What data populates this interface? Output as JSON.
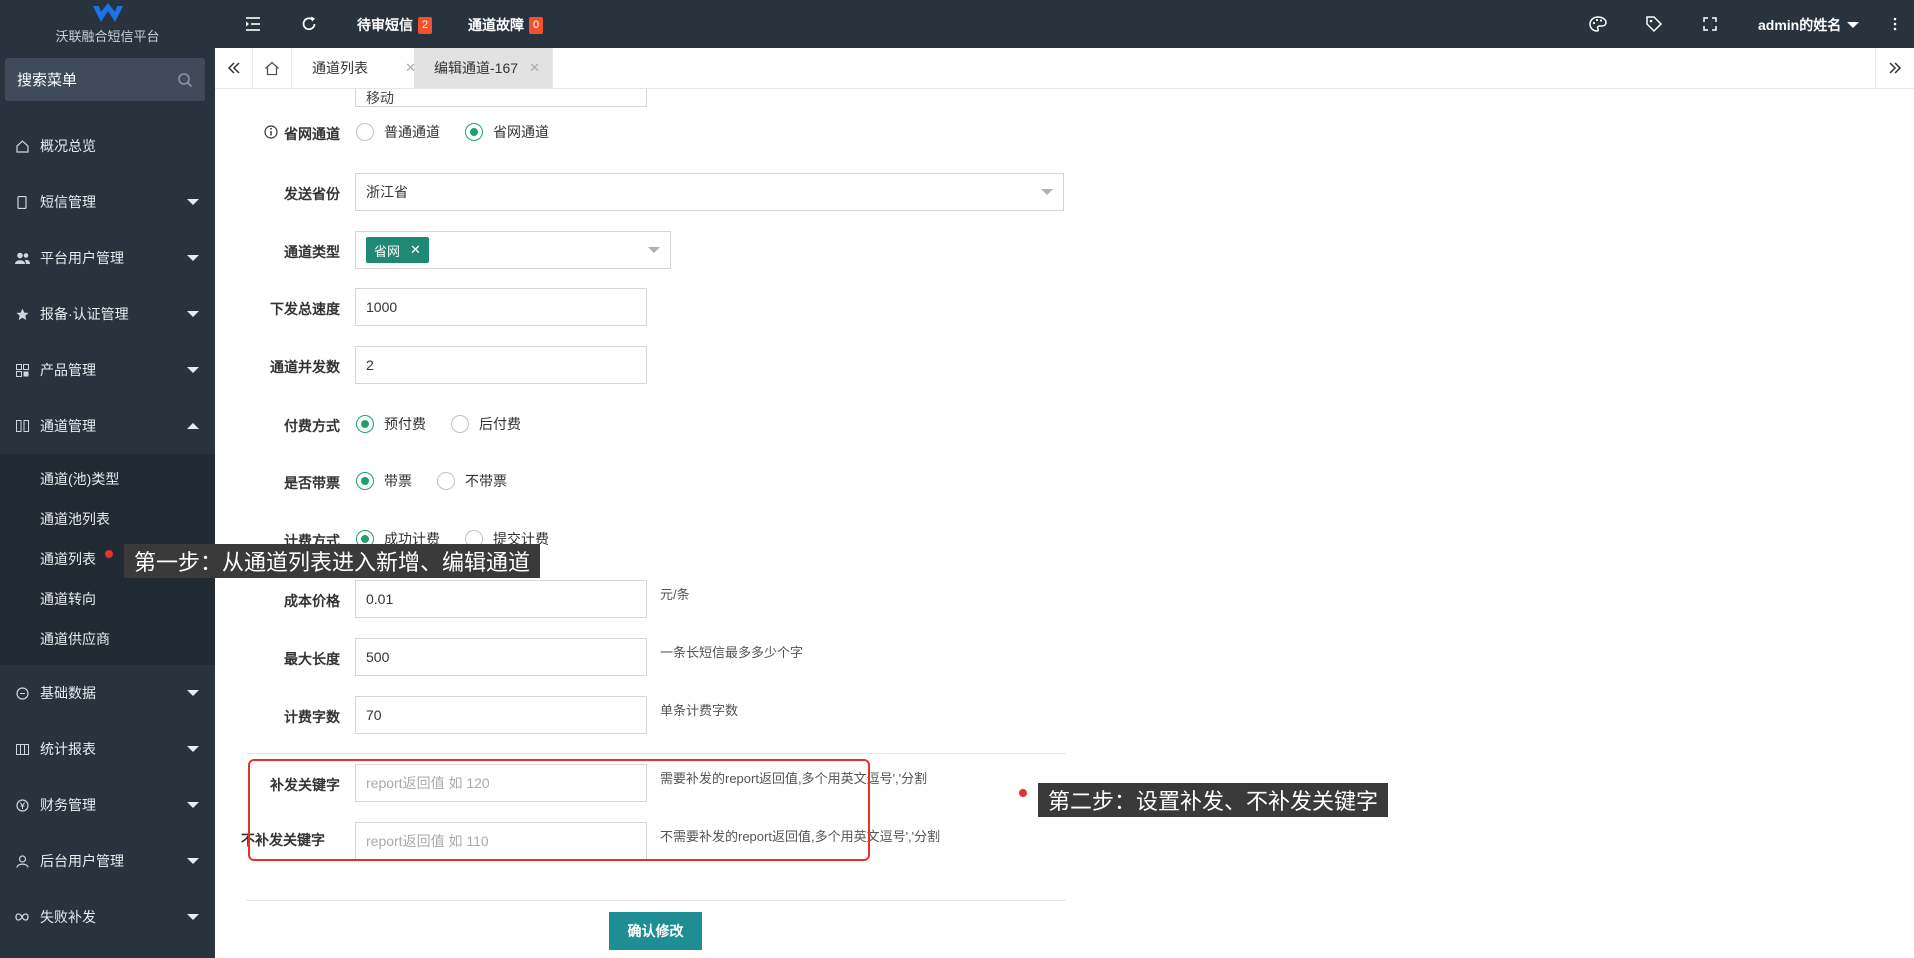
{
  "app": {
    "name": "沃联融合短信平台",
    "accent": "#1e8e94",
    "sidebar_bg": "#28333e",
    "highlight": "#e8312b"
  },
  "sidebar": {
    "search_placeholder": "搜索菜单",
    "items": [
      {
        "label": "概况总览",
        "icon": "home-icon"
      },
      {
        "label": "短信管理",
        "icon": "phone-icon"
      },
      {
        "label": "平台用户管理",
        "icon": "users-icon"
      },
      {
        "label": "报备·认证管理",
        "icon": "star-icon"
      },
      {
        "label": "产品管理",
        "icon": "product-icon"
      },
      {
        "label": "通道管理",
        "icon": "channel-icon",
        "expanded": true
      },
      {
        "label": "基础数据",
        "icon": "data-icon"
      },
      {
        "label": "统计报表",
        "icon": "report-icon"
      },
      {
        "label": "财务管理",
        "icon": "yen-icon"
      },
      {
        "label": "后台用户管理",
        "icon": "user-icon"
      },
      {
        "label": "失败补发",
        "icon": "infinity-icon"
      }
    ],
    "subitems": [
      "通道(池)类型",
      "通道池列表",
      "通道列表",
      "通道转向",
      "通道供应商"
    ]
  },
  "topbar": {
    "pending_sms": "待审短信",
    "pending_sms_count": "2",
    "channel_fault": "通道故障",
    "channel_fault_count": "0",
    "user": "admin的姓名"
  },
  "tabs": [
    {
      "label": "通道列表",
      "active": false
    },
    {
      "label": "编辑通道-167",
      "active": true
    }
  ],
  "form": {
    "partial_value": "移动",
    "province_channel": {
      "label": "省网通道",
      "options": [
        "普通通道",
        "省网通道"
      ],
      "selected": 1
    },
    "send_province": {
      "label": "发送省份",
      "value": "浙江省"
    },
    "channel_type": {
      "label": "通道类型",
      "tags": [
        "省网"
      ]
    },
    "total_speed": {
      "label": "下发总速度",
      "value": "1000"
    },
    "concurrency": {
      "label": "通道并发数",
      "value": "2"
    },
    "payment": {
      "label": "付费方式",
      "options": [
        "预付费",
        "后付费"
      ],
      "selected": 0
    },
    "ticket": {
      "label": "是否带票",
      "options": [
        "带票",
        "不带票"
      ],
      "selected": 0
    },
    "billing": {
      "label": "计费方式",
      "options": [
        "成功计费",
        "提交计费"
      ],
      "selected": 0
    },
    "cost_price": {
      "label": "成本价格",
      "value": "0.01",
      "hint": "元/条"
    },
    "max_length": {
      "label": "最大长度",
      "value": "500",
      "hint": "一条长短信最多多少个字"
    },
    "billing_chars": {
      "label": "计费字数",
      "value": "70",
      "hint": "单条计费字数"
    },
    "resend_keywords": {
      "label": "补发关键字",
      "placeholder": "report返回值 如 120",
      "hint": "需要补发的report返回值,多个用英文逗号','分割"
    },
    "no_resend_keywords": {
      "label": "不补发关键字",
      "placeholder": "report返回值 如 110",
      "hint": "不需要补发的report返回值,多个用英文逗号','分割"
    },
    "submit": "确认修改"
  },
  "annotations": {
    "step1": "第一步：从通道列表进入新增、编辑通道",
    "step2": "第二步：设置补发、不补发关键字"
  }
}
